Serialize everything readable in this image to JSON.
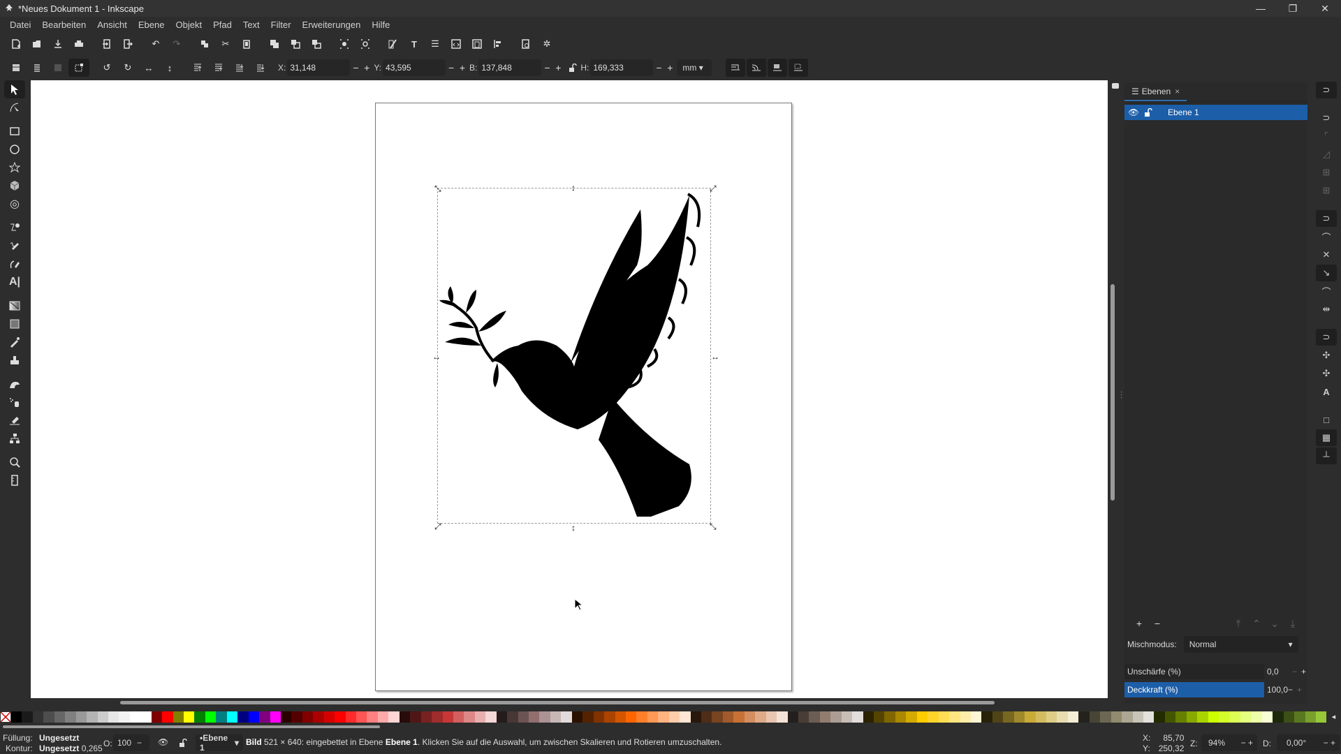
{
  "window": {
    "title": "*Neues Dokument 1 - Inkscape",
    "controls": [
      "minimize-icon",
      "restore-icon",
      "close-icon"
    ]
  },
  "menu": [
    "Datei",
    "Bearbeiten",
    "Ansicht",
    "Ebene",
    "Objekt",
    "Pfad",
    "Text",
    "Filter",
    "Erweiterungen",
    "Hilfe"
  ],
  "commands": {
    "icons": [
      "new-document-icon",
      "open-icon",
      "save-icon",
      "print-icon",
      "import-icon",
      "export-icon",
      "undo-icon",
      "redo-icon",
      "duplicate-icon",
      "cut-icon",
      "paste-icon",
      "group-icon",
      "clone-icon",
      "unlink-clone-icon",
      "zoom-selection-icon",
      "zoom-drawing-icon",
      "fill-stroke-icon",
      "text-font-icon",
      "layers-icon",
      "xml-editor-icon",
      "objects-icon",
      "align-icon",
      "document-properties-icon",
      "preferences-icon"
    ]
  },
  "toolcontrols": {
    "x_label": "X:",
    "x_value": "31,148",
    "y_label": "Y:",
    "y_value": "43,595",
    "w_label": "B:",
    "w_value": "137,848",
    "h_label": "H:",
    "h_value": "169,333",
    "unit": "mm",
    "minus": "−",
    "plus": "+"
  },
  "tools": [
    "selector-tool-icon",
    "node-tool-icon",
    "rectangle-tool-icon",
    "ellipse-tool-icon",
    "star-tool-icon",
    "box-3d-tool-icon",
    "spiral-tool-icon",
    "bezier-tool-icon",
    "pencil-tool-icon",
    "calligraphy-tool-icon",
    "text-tool-icon",
    "gradient-tool-icon",
    "mesh-tool-icon",
    "dropper-tool-icon",
    "paint-bucket-tool-icon",
    "tweak-tool-icon",
    "spray-tool-icon",
    "eraser-tool-icon",
    "connector-tool-icon",
    "zoom-tool-icon",
    "measure-tool-icon"
  ],
  "layers_panel": {
    "tab_label": "Ebenen",
    "tab_close": "×",
    "layer_name": "Ebene 1",
    "blend_label": "Mischmodus:",
    "blend_value": "Normal",
    "blur_label": "Unschärfe (%)",
    "blur_value": "0,0",
    "opacity_label": "Deckkraft (%)",
    "opacity_value": "100,0"
  },
  "status": {
    "fill_label": "Füllung:",
    "fill_value": "Ungesetzt",
    "stroke_label": "Kontur:",
    "stroke_value": "Ungesetzt",
    "stroke_width": "0,265",
    "opacity_label": "O:",
    "opacity_value": "100",
    "layer": "•Ebene 1",
    "msg_obj": "Bild",
    "msg_dims": " 521 × 640: eingebettet in Ebene ",
    "msg_layer": "Ebene 1",
    "msg_rest": ". Klicken Sie auf die Auswahl, um zwischen Skalieren und Rotieren umzuschalten.",
    "cursor_x_label": "X:",
    "cursor_x": "85,70",
    "cursor_y_label": "Y:",
    "cursor_y": "250,32",
    "zoom_label": "Z:",
    "zoom_value": "94%",
    "rotation_label": "D:",
    "rotation_value": "0,00°"
  },
  "palette": [
    "#000000",
    "#1a1a1a",
    "#333333",
    "#4d4d4d",
    "#666666",
    "#808080",
    "#999999",
    "#b3b3b3",
    "#cccccc",
    "#e6e6e6",
    "#f2f2f2",
    "#ffffff",
    "#ffffff",
    "#800000",
    "#ff0000",
    "#808000",
    "#ffff00",
    "#008000",
    "#00ff00",
    "#008080",
    "#00ffff",
    "#000080",
    "#0000ff",
    "#800080",
    "#ff00ff",
    "#2b0000",
    "#550000",
    "#800000",
    "#aa0000",
    "#d40000",
    "#ff0000",
    "#ff2a2a",
    "#ff5555",
    "#ff8080",
    "#ffaaaa",
    "#ffd5d5",
    "#280b0b",
    "#501616",
    "#782121",
    "#a02c2c",
    "#c83737",
    "#d35f5f",
    "#de8787",
    "#e9afaf",
    "#f4d7d7",
    "#241c1c",
    "#483737",
    "#6c5353",
    "#916f6f",
    "#ac9393",
    "#c8b7b7",
    "#e3dbdb",
    "#2b1100",
    "#552200",
    "#803300",
    "#aa4400",
    "#d45500",
    "#ff6600",
    "#ff7f2a",
    "#ff9955",
    "#ffb380",
    "#ffccaa",
    "#ffe6d5",
    "#28170b",
    "#502d16",
    "#784421",
    "#a05a2c",
    "#c87137",
    "#d38d5f",
    "#deaa87",
    "#e9c6af",
    "#f4e3d7",
    "#241f1c",
    "#483e37",
    "#6c5d53",
    "#917c6f",
    "#ac9d93",
    "#c8beb7",
    "#e3dedb",
    "#2b2200",
    "#554400",
    "#806600",
    "#aa8800",
    "#d4aa00",
    "#ffcc00",
    "#ffd42a",
    "#ffdd55",
    "#ffe680",
    "#ffeeaa",
    "#fff6d5",
    "#28220b",
    "#504416",
    "#786721",
    "#a0892c",
    "#c8ab37",
    "#d3bc5f",
    "#decd87",
    "#e9ddaf",
    "#f4eed7",
    "#24221c",
    "#484537",
    "#6c6753",
    "#918a6f",
    "#aca793",
    "#c8c4b7",
    "#e3e2db",
    "#222b00",
    "#445500",
    "#668000",
    "#88aa00",
    "#aad400",
    "#ccff00",
    "#d4ff2a",
    "#ddff55",
    "#e5ff80",
    "#eeffaa",
    "#f6ffd5",
    "#1e280b",
    "#3c5016",
    "#5a7821",
    "#78a02c",
    "#96c837"
  ]
}
